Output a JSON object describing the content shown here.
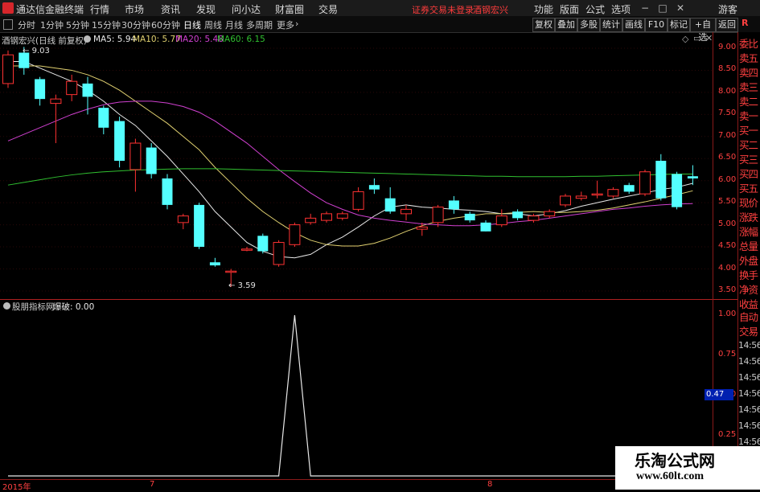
{
  "title_bar": {
    "app_name": "通达信金融终端",
    "menu": [
      "行情",
      "市场",
      "资讯",
      "发现",
      "问小达",
      "财富圈",
      "交易"
    ],
    "notice": "证券交易未登录",
    "stock_name": "酒钢宏兴",
    "right_menu": [
      "功能",
      "版面",
      "公式",
      "选项"
    ],
    "guest": "游客",
    "r_label": "R"
  },
  "toolbar": {
    "periods": [
      "分时",
      "1分钟",
      "5分钟",
      "15分钟",
      "30分钟",
      "60分钟",
      "日线",
      "周线",
      "月线",
      "多周期",
      "更多"
    ],
    "active_period": "日线",
    "right_buttons": [
      "复权",
      "叠加",
      "多股",
      "统计",
      "画线",
      "F10",
      "标记",
      "+自选",
      "返回"
    ]
  },
  "main_chart": {
    "header": {
      "title": "酒钢宏兴(日线 前复权)",
      "ma5": "MA5: 5.94",
      "ma10": "MA10: 5.77",
      "ma20": "MA20: 5.48",
      "ma60": "MA60: 6.15"
    },
    "high_label": "9.03",
    "low_label": "3.59",
    "y_ticks": [
      "9.00",
      "8.50",
      "8.00",
      "7.50",
      "7.00",
      "6.50",
      "6.00",
      "5.50",
      "5.00",
      "4.50",
      "4.00",
      "3.50"
    ]
  },
  "sub_chart": {
    "header_name": "股朋指标网",
    "header_value": "爆破: 0.00",
    "y_ticks": [
      "1.00",
      "0.75",
      "0.50",
      "0.25"
    ],
    "cursor_value": "0.47"
  },
  "date_axis": {
    "labels": [
      "2015年",
      "7",
      "8"
    ]
  },
  "right_panel": {
    "items": [
      "委比",
      "卖五",
      "卖四",
      "卖三",
      "卖二",
      "卖一",
      "买一",
      "买二",
      "买三",
      "买四",
      "买五",
      "现价",
      "涨跌",
      "涨幅",
      "总量",
      "外盘",
      "换手",
      "净资",
      "收益"
    ],
    "sub_items": [
      "自动",
      "交易"
    ],
    "times": [
      "14:56",
      "14:56",
      "14:56",
      "14:56",
      "14:56",
      "14:56",
      "14:56",
      "14:56"
    ]
  },
  "watermark": {
    "title": "乐淘公式网",
    "url": "www.60lt.com"
  },
  "chart_data": {
    "type": "candlestick",
    "title": "酒钢宏兴(日线 前复权)",
    "ylim": [
      3.3,
      9.3
    ],
    "up_color": "#ff3232",
    "down_color": "#54ffff",
    "candles": [
      {
        "o": 8.2,
        "h": 8.95,
        "l": 8.1,
        "c": 8.85
      },
      {
        "o": 8.9,
        "h": 9.03,
        "l": 8.4,
        "c": 8.55
      },
      {
        "o": 8.3,
        "h": 8.35,
        "l": 7.7,
        "c": 7.85
      },
      {
        "o": 7.75,
        "h": 7.95,
        "l": 6.85,
        "c": 7.85
      },
      {
        "o": 7.95,
        "h": 8.4,
        "l": 7.8,
        "c": 8.25
      },
      {
        "o": 8.2,
        "h": 8.35,
        "l": 7.5,
        "c": 7.9
      },
      {
        "o": 7.65,
        "h": 7.7,
        "l": 7.05,
        "c": 7.2
      },
      {
        "o": 7.35,
        "h": 7.45,
        "l": 6.3,
        "c": 6.45
      },
      {
        "o": 6.25,
        "h": 6.95,
        "l": 5.75,
        "c": 6.85
      },
      {
        "o": 6.75,
        "h": 6.85,
        "l": 6.05,
        "c": 6.15
      },
      {
        "o": 6.05,
        "h": 6.15,
        "l": 5.35,
        "c": 5.45
      },
      {
        "o": 5.05,
        "h": 5.25,
        "l": 4.9,
        "c": 5.2
      },
      {
        "o": 5.45,
        "h": 5.5,
        "l": 4.45,
        "c": 4.5
      },
      {
        "o": 4.15,
        "h": 4.25,
        "l": 4.05,
        "c": 4.08
      },
      {
        "o": 3.95,
        "h": 4.0,
        "l": 3.59,
        "c": 3.95
      },
      {
        "o": 4.45,
        "h": 4.5,
        "l": 4.4,
        "c": 4.45
      },
      {
        "o": 4.75,
        "h": 4.8,
        "l": 4.35,
        "c": 4.4
      },
      {
        "o": 4.1,
        "h": 4.65,
        "l": 4.05,
        "c": 4.6
      },
      {
        "o": 4.55,
        "h": 5.05,
        "l": 4.5,
        "c": 5.0
      },
      {
        "o": 5.05,
        "h": 5.25,
        "l": 5.0,
        "c": 5.15
      },
      {
        "o": 5.1,
        "h": 5.3,
        "l": 5.05,
        "c": 5.25
      },
      {
        "o": 5.15,
        "h": 5.3,
        "l": 5.1,
        "c": 5.25
      },
      {
        "o": 5.35,
        "h": 5.85,
        "l": 5.3,
        "c": 5.75
      },
      {
        "o": 5.9,
        "h": 6.05,
        "l": 5.7,
        "c": 5.8
      },
      {
        "o": 5.6,
        "h": 5.85,
        "l": 5.25,
        "c": 5.3
      },
      {
        "o": 5.25,
        "h": 5.45,
        "l": 5.1,
        "c": 5.35
      },
      {
        "o": 4.9,
        "h": 5.05,
        "l": 4.75,
        "c": 4.95
      },
      {
        "o": 5.05,
        "h": 5.45,
        "l": 4.95,
        "c": 5.4
      },
      {
        "o": 5.55,
        "h": 5.65,
        "l": 5.25,
        "c": 5.35
      },
      {
        "o": 5.25,
        "h": 5.3,
        "l": 5.05,
        "c": 5.1
      },
      {
        "o": 5.05,
        "h": 5.1,
        "l": 4.85,
        "c": 4.85
      },
      {
        "o": 5.0,
        "h": 5.35,
        "l": 4.95,
        "c": 5.2
      },
      {
        "o": 5.3,
        "h": 5.35,
        "l": 5.1,
        "c": 5.15
      },
      {
        "o": 5.1,
        "h": 5.25,
        "l": 5.05,
        "c": 5.2
      },
      {
        "o": 5.2,
        "h": 5.35,
        "l": 5.15,
        "c": 5.3
      },
      {
        "o": 5.45,
        "h": 5.7,
        "l": 5.4,
        "c": 5.65
      },
      {
        "o": 5.6,
        "h": 5.75,
        "l": 5.55,
        "c": 5.65
      },
      {
        "o": 5.7,
        "h": 6.0,
        "l": 5.6,
        "c": 5.7
      },
      {
        "o": 5.65,
        "h": 5.85,
        "l": 5.6,
        "c": 5.8
      },
      {
        "o": 5.9,
        "h": 5.95,
        "l": 5.7,
        "c": 5.75
      },
      {
        "o": 5.7,
        "h": 6.25,
        "l": 5.65,
        "c": 6.2
      },
      {
        "o": 6.45,
        "h": 6.6,
        "l": 5.55,
        "c": 5.6
      },
      {
        "o": 6.15,
        "h": 6.2,
        "l": 5.35,
        "c": 5.4
      },
      {
        "o": 6.1,
        "h": 6.35,
        "l": 5.9,
        "c": 6.05
      }
    ],
    "ma_series": [
      {
        "name": "MA5",
        "color": "#e8e8e8",
        "values": [
          8.7,
          8.7,
          8.55,
          8.4,
          8.25,
          8.05,
          7.8,
          7.5,
          7.25,
          6.9,
          6.55,
          6.15,
          5.75,
          5.3,
          4.95,
          4.6,
          4.4,
          4.28,
          4.25,
          4.33,
          4.55,
          4.72,
          4.95,
          5.2,
          5.4,
          5.45,
          5.4,
          5.38,
          5.35,
          5.33,
          5.3,
          5.25,
          5.25,
          5.2,
          5.25,
          5.32,
          5.42,
          5.5,
          5.58,
          5.65,
          5.72,
          5.8,
          5.85,
          5.94
        ]
      },
      {
        "name": "MA10",
        "color": "#e0d070",
        "values": [
          8.6,
          8.6,
          8.6,
          8.55,
          8.5,
          8.4,
          8.25,
          8.05,
          7.8,
          7.55,
          7.3,
          7.0,
          6.7,
          6.3,
          5.95,
          5.6,
          5.3,
          5.05,
          4.82,
          4.65,
          4.55,
          4.52,
          4.52,
          4.58,
          4.7,
          4.85,
          4.98,
          5.08,
          5.15,
          5.2,
          5.25,
          5.25,
          5.28,
          5.3,
          5.28,
          5.28,
          5.3,
          5.33,
          5.38,
          5.45,
          5.52,
          5.6,
          5.68,
          5.77
        ]
      },
      {
        "name": "MA20",
        "color": "#d040d0",
        "values": [
          6.9,
          7.05,
          7.2,
          7.35,
          7.5,
          7.62,
          7.72,
          7.78,
          7.8,
          7.8,
          7.76,
          7.68,
          7.55,
          7.35,
          7.1,
          6.85,
          6.55,
          6.25,
          5.98,
          5.72,
          5.5,
          5.35,
          5.22,
          5.15,
          5.1,
          5.06,
          5.02,
          5.0,
          4.98,
          4.98,
          5.0,
          5.03,
          5.07,
          5.1,
          5.15,
          5.2,
          5.25,
          5.3,
          5.35,
          5.38,
          5.42,
          5.45,
          5.47,
          5.48
        ]
      },
      {
        "name": "MA60",
        "color": "#30c030",
        "values": [
          5.9,
          5.96,
          6.02,
          6.08,
          6.13,
          6.17,
          6.2,
          6.22,
          6.24,
          6.25,
          6.26,
          6.27,
          6.27,
          6.27,
          6.26,
          6.25,
          6.24,
          6.23,
          6.22,
          6.21,
          6.2,
          6.19,
          6.18,
          6.17,
          6.16,
          6.15,
          6.14,
          6.13,
          6.12,
          6.11,
          6.1,
          6.1,
          6.09,
          6.09,
          6.09,
          6.09,
          6.1,
          6.1,
          6.11,
          6.12,
          6.13,
          6.14,
          6.15,
          6.15
        ]
      }
    ],
    "indicator": {
      "name": "爆破",
      "ylim": [
        0,
        1.0
      ],
      "spike_index": 18,
      "values": [
        0,
        0,
        0,
        0,
        0,
        0,
        0,
        0,
        0,
        0,
        0,
        0,
        0,
        0,
        0,
        0,
        0,
        0,
        1.0,
        0,
        0,
        0,
        0,
        0,
        0,
        0,
        0,
        0,
        0,
        0,
        0,
        0,
        0,
        0,
        0,
        0,
        0,
        0,
        0,
        0,
        0,
        0,
        0,
        0
      ]
    }
  }
}
